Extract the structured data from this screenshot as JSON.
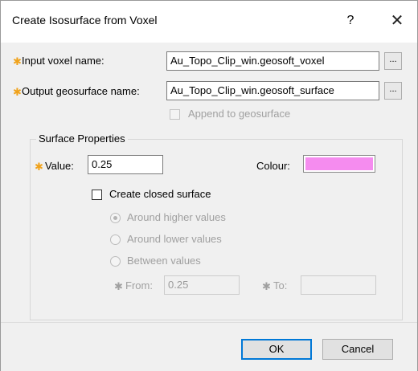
{
  "window": {
    "title": "Create Isosurface from Voxel",
    "help_glyph": "?",
    "close_glyph": "✕"
  },
  "required_marker": "✱",
  "fields": {
    "input_voxel": {
      "label": "Input voxel name:",
      "value": "Au_Topo_Clip_win.geosoft_voxel",
      "browse_label": "..."
    },
    "output_surface": {
      "label": "Output geosurface name:",
      "value": "Au_Topo_Clip_win.geosoft_surface",
      "browse_label": "..."
    },
    "append": {
      "label": "Append to geosurface",
      "checked": false,
      "enabled": false
    }
  },
  "surface_properties": {
    "group_label": "Surface Properties",
    "value_label": "Value:",
    "value": "0.25",
    "colour_label": "Colour:",
    "colour": "#f58cef",
    "closed_surface_label": "Create closed surface",
    "closed_surface_checked": false,
    "radio_options": [
      {
        "label": "Around higher values",
        "selected": true
      },
      {
        "label": "Around lower values",
        "selected": false
      },
      {
        "label": "Between values",
        "selected": false
      }
    ],
    "from_label": "From:",
    "from_value": "0.25",
    "to_label": "To:",
    "to_value": ""
  },
  "buttons": {
    "ok": "OK",
    "cancel": "Cancel"
  }
}
